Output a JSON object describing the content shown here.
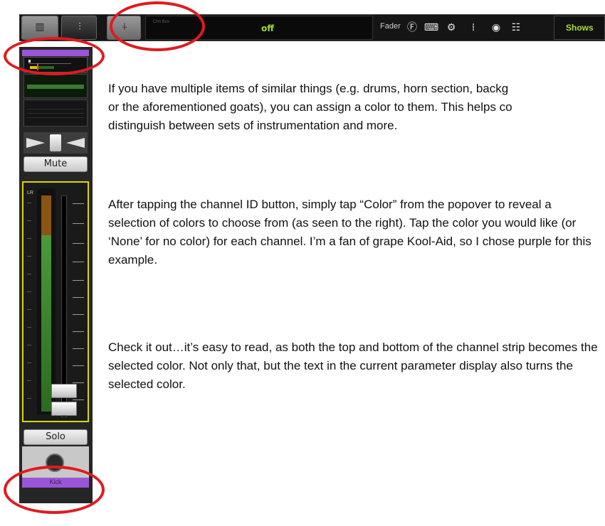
{
  "toolbar": {
    "param_display_small": "Chn Bus",
    "param_value": "off",
    "fader_label": "Fader",
    "icons": [
      "mixer-icon",
      "eq-sliders-icon",
      "fader-icon",
      "fx-icon",
      "keyboard-icon",
      "gear-icon",
      "patch-icon",
      "record-icon",
      "meter-icon"
    ],
    "shows_label": "Shows"
  },
  "channel": {
    "mute_label": "Mute",
    "solo_label": "Solo",
    "meter_label": "LR",
    "name_label": "Kick",
    "color": "#9b55d8"
  },
  "body": {
    "paragraph1_lines": [
      "If you have multiple items of similar things (e.g. drums, horn section, backg",
      "or the aforementioned goats), you can assign a color to them. This helps co",
      "distinguish between sets of instrumentation and more."
    ],
    "paragraph2": "After tapping the channel ID button, simply tap “Color” from the popover to reveal a selection of colors to choose from (as seen to the right). Tap the color you would like (or ‘None’ for no color) for each channel. I’m a fan of grape Kool-Aid, so I chose purple for this example.",
    "paragraph3": "Check it out…it’s easy to read, as both the top and bottom of the channel strip becomes the selected color. Not only that, but the text in the current parameter display also turns the selected color."
  },
  "annotation_color": "#e01a1f"
}
